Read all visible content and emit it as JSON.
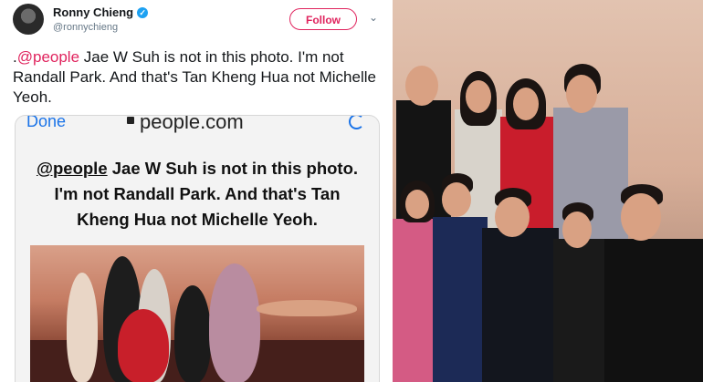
{
  "tweet": {
    "author_name": "Ronny Chieng",
    "author_handle": "@ronnychieng",
    "follow_label": "Follow",
    "text_prefix": ".",
    "mention": "@people",
    "text_body": " Jae W Suh is not in this photo. I'm not Randall Park. And that's Tan Kheng Hua not Michelle Yeoh."
  },
  "embedded_screenshot": {
    "done_label": "Done",
    "url": "people.com",
    "caption_mention": "@people",
    "caption_body": " Jae W Suh is not in this photo. I'm not Randall Park. And that's Tan Kheng Hua not Michelle Yeoh."
  },
  "colors": {
    "mention": "#e0245e",
    "follow": "#e0245e",
    "verified": "#1da1f2",
    "ios_blue": "#1a73e8"
  },
  "icons": {
    "verified": "verified-badge-icon",
    "chevron": "chevron-down-icon",
    "lock": "lock-icon",
    "reload": "reload-icon"
  }
}
